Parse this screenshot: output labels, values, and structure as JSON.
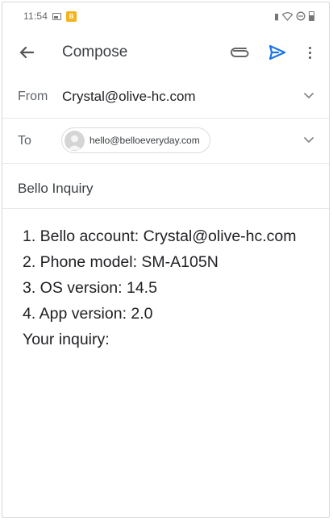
{
  "status_bar": {
    "time": "11:54",
    "app_badge": "B",
    "icons": [
      "gallery-icon",
      "app-notification-icon",
      "vibrate-icon",
      "wifi-icon",
      "no-disturb-icon",
      "battery-icon"
    ]
  },
  "toolbar": {
    "title": "Compose",
    "icons": [
      "back-arrow-icon",
      "paperclip-icon",
      "send-icon",
      "more-vert-icon"
    ],
    "accent_color": "#1a73e8"
  },
  "from": {
    "label": "From",
    "value": "Crystal@olive-hc.com"
  },
  "to": {
    "label": "To",
    "recipients": [
      {
        "email": "hello@belloeveryday.com"
      }
    ]
  },
  "subject": {
    "value": "Bello Inquiry"
  },
  "body": {
    "lines": [
      "1. Bello account: Crystal@olive-hc.com",
      "2. Phone model: SM-A105N",
      "3. OS version: 14.5",
      "4. App version: 2.0",
      "Your inquiry:"
    ]
  }
}
